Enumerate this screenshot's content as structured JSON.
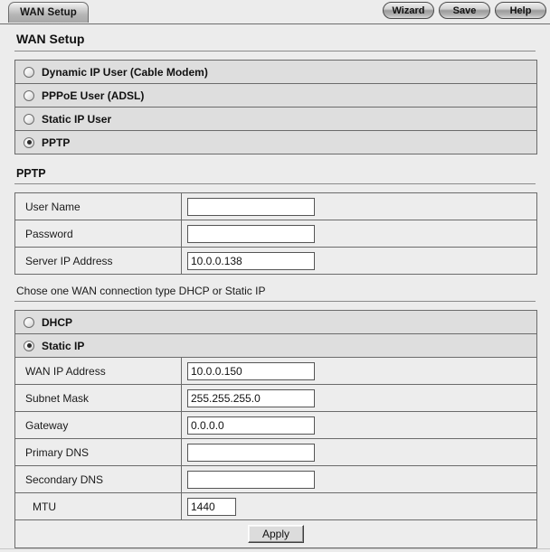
{
  "tab": {
    "label": "WAN Setup"
  },
  "toolbar": {
    "wizard_label": "Wizard",
    "save_label": "Save",
    "help_label": "Help"
  },
  "page": {
    "title": "WAN Setup"
  },
  "connection_types": {
    "options": [
      {
        "label": "Dynamic IP User (Cable Modem)",
        "selected": false
      },
      {
        "label": "PPPoE User (ADSL)",
        "selected": false
      },
      {
        "label": "Static IP User",
        "selected": false
      },
      {
        "label": "PPTP",
        "selected": true
      }
    ]
  },
  "pptp": {
    "heading": "PPTP",
    "fields": [
      {
        "label": "User Name",
        "value": "",
        "width": "wide"
      },
      {
        "label": "Password",
        "value": "",
        "width": "wide"
      },
      {
        "label": "Server IP Address",
        "value": "10.0.0.138",
        "width": "wide"
      }
    ]
  },
  "wan_mode": {
    "note": "Chose one WAN connection type DHCP or Static IP",
    "options": [
      {
        "label": "DHCP",
        "selected": false
      },
      {
        "label": "Static IP",
        "selected": true
      }
    ],
    "fields": [
      {
        "label": "WAN IP Address",
        "value": "10.0.0.150",
        "width": "wide"
      },
      {
        "label": "Subnet Mask",
        "value": "255.255.255.0",
        "width": "wide"
      },
      {
        "label": "Gateway",
        "value": "0.0.0.0",
        "width": "wide"
      },
      {
        "label": "Primary DNS",
        "value": "",
        "width": "wide"
      },
      {
        "label": "Secondary DNS",
        "value": "",
        "width": "wide"
      },
      {
        "label": "MTU",
        "value": "1440",
        "width": "narrow"
      }
    ],
    "apply_label": "Apply"
  },
  "colors": {
    "page_bg": "#ececec",
    "row_bg": "#ededed",
    "radio_row_bg": "#dedede",
    "border": "#6b6b6b",
    "text": "#1a1a1a"
  }
}
